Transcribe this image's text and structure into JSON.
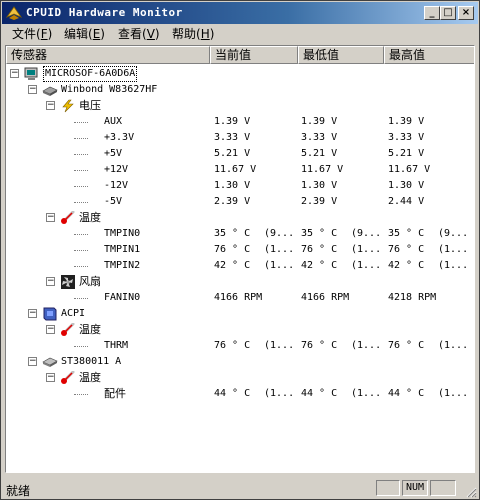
{
  "window": {
    "title": "CPUID Hardware Monitor"
  },
  "titlebar_buttons": {
    "minimize": "_",
    "maximize": "□",
    "close": "×"
  },
  "menu": [
    {
      "label": "文件",
      "key": "F"
    },
    {
      "label": "编辑",
      "key": "E"
    },
    {
      "label": "查看",
      "key": "V"
    },
    {
      "label": "帮助",
      "key": "H"
    }
  ],
  "columns": [
    "传感器",
    "当前值",
    "最低值",
    "最高值"
  ],
  "tree": [
    {
      "kind": "node",
      "label": "MICROSOF-6A0D6A",
      "icon": "computer-icon",
      "level": 0
    },
    {
      "kind": "node",
      "label": "Winbond W83627HF",
      "icon": "chip-icon",
      "level": 1
    },
    {
      "kind": "node",
      "label": "电压",
      "icon": "voltage-icon",
      "level": 2
    },
    {
      "kind": "leaf",
      "label": "AUX",
      "cur": "1.39 V",
      "min": "1.39 V",
      "max": "1.39 V"
    },
    {
      "kind": "leaf",
      "label": "+3.3V",
      "cur": "3.33 V",
      "min": "3.33 V",
      "max": "3.33 V"
    },
    {
      "kind": "leaf",
      "label": "+5V",
      "cur": "5.21 V",
      "min": "5.21 V",
      "max": "5.21 V"
    },
    {
      "kind": "leaf",
      "label": "+12V",
      "cur": "11.67 V",
      "min": "11.67 V",
      "max": "11.67 V"
    },
    {
      "kind": "leaf",
      "label": "-12V",
      "cur": "1.30 V",
      "min": "1.30 V",
      "max": "1.30 V"
    },
    {
      "kind": "leaf",
      "label": "-5V",
      "cur": "2.39 V",
      "min": "2.39 V",
      "max": "2.44 V"
    },
    {
      "kind": "node",
      "label": "温度",
      "icon": "thermometer-icon",
      "level": 2
    },
    {
      "kind": "leaf",
      "label": "TMPIN0",
      "cur": "35 ° C",
      "cur2": "(9...",
      "min": "35 ° C",
      "min2": "(9...",
      "max": "35 ° C",
      "max2": "(9..."
    },
    {
      "kind": "leaf",
      "label": "TMPIN1",
      "cur": "76 ° C",
      "cur2": "(1...",
      "min": "76 ° C",
      "min2": "(1...",
      "max": "76 ° C",
      "max2": "(1..."
    },
    {
      "kind": "leaf",
      "label": "TMPIN2",
      "cur": "42 ° C",
      "cur2": "(1...",
      "min": "42 ° C",
      "min2": "(1...",
      "max": "42 ° C",
      "max2": "(1..."
    },
    {
      "kind": "node",
      "label": "风扇",
      "icon": "fan-icon",
      "level": 2
    },
    {
      "kind": "leaf",
      "label": "FANIN0",
      "cur": "4166 RPM",
      "min": "4166 RPM",
      "max": "4218 RPM"
    },
    {
      "kind": "node",
      "label": "ACPI",
      "icon": "acpi-icon",
      "level": 1
    },
    {
      "kind": "node",
      "label": "温度",
      "icon": "thermometer-icon",
      "level": 2
    },
    {
      "kind": "leaf",
      "label": "THRM",
      "cur": "76 ° C",
      "cur2": "(1...",
      "min": "76 ° C",
      "min2": "(1...",
      "max": "76 ° C",
      "max2": "(1..."
    },
    {
      "kind": "node",
      "label": "ST380011 A",
      "icon": "hdd-icon",
      "level": 1
    },
    {
      "kind": "node",
      "label": "温度",
      "icon": "thermometer-icon",
      "level": 2
    },
    {
      "kind": "leaf",
      "label": "配件",
      "cur": "44 ° C",
      "cur2": "(1...",
      "min": "44 ° C",
      "min2": "(1...",
      "max": "44 ° C",
      "max2": "(1..."
    }
  ],
  "status": {
    "text": "就绪",
    "num": "NUM"
  }
}
